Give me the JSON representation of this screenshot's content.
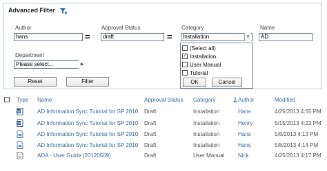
{
  "panel": {
    "title": "Advanced Filter",
    "filter_icon": "filter-icon",
    "author": {
      "label": "Author",
      "value": "hans"
    },
    "approval": {
      "label": "Approval Status",
      "value": "draft"
    },
    "category": {
      "label": "Category",
      "value": "Installation"
    },
    "name": {
      "label": "Name",
      "value": "AD"
    },
    "equals": "=",
    "department": {
      "label": "Department",
      "value": "Please select..."
    },
    "reset_label": "Reset",
    "filter_label": "Filter"
  },
  "category_dropdown": {
    "options": [
      {
        "label": "(Select all)",
        "checked": false
      },
      {
        "label": "Installation",
        "checked": true
      },
      {
        "label": "User Manual",
        "checked": false
      },
      {
        "label": "Tutorial",
        "checked": false
      }
    ],
    "ok_label": "OK",
    "cancel_label": "Cancel"
  },
  "table": {
    "headers": {
      "type": "Type",
      "name": "Name",
      "approval": "Approval Status",
      "category": "Category",
      "author": "Author",
      "modified": "Modified"
    },
    "sort_icon": "sort-arrow-icon",
    "rows": [
      {
        "icon": "word-doc-icon",
        "name": "AD Information Sync Tutorial for SP 2010",
        "approval": "Draft",
        "category": "Installation",
        "author": "Hans",
        "modified": "4/25/2013 4:55 PM"
      },
      {
        "icon": "word-doc-icon",
        "name": "AD Information Sync Tutorial for SP 2010",
        "approval": "Draft",
        "category": "Installation",
        "author": "Henry",
        "modified": "5/15/2013 4:22 PM"
      },
      {
        "icon": "generic-doc-icon",
        "name": "AD Information Sync Tutorial for SP 2010",
        "approval": "Draft",
        "category": "Installation",
        "author": "Hans",
        "modified": "5/8/2013 4:13 PM"
      },
      {
        "icon": "generic-doc-icon",
        "name": "AD Information Sync Tutorial for SP 2010",
        "approval": "Draft",
        "category": "Installation",
        "author": "Hans",
        "modified": "5/8/2013 4:14 PM"
      },
      {
        "icon": "text-doc-icon",
        "name": "ADA - User Guide (20120509)",
        "approval": "Draft",
        "category": "User Manual",
        "author": "Nick",
        "modified": "4/25/2013 4:17 PM"
      }
    ]
  },
  "colors": {
    "link": "#3b6ea5",
    "border": "#b9c4cf",
    "word_blue": "#2b5797"
  }
}
